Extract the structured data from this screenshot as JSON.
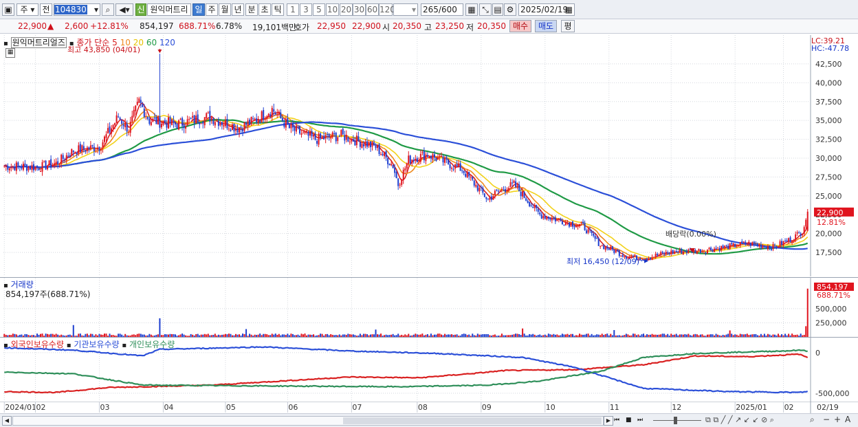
{
  "toolbar": {
    "market": "주",
    "prev_label": "전",
    "code": "104830",
    "new_badge": "신",
    "stock_name": "원익머트리",
    "periods": [
      "일",
      "주",
      "월",
      "년",
      "분",
      "초",
      "틱"
    ],
    "active_period": "일",
    "intervals": [
      "1",
      "3",
      "5",
      "10",
      "20",
      "30",
      "60",
      "120"
    ],
    "count_value": "265",
    "count_max": "/600",
    "date": "2025/02/19"
  },
  "quote": {
    "price": "22,900",
    "change": "2,600",
    "change_pct": "+12.81%",
    "volume": "854,197",
    "volume_ratio": "688.71%",
    "turnover": "6.78%",
    "amount": "19,101백만",
    "ask_label": "호가",
    "ask": "22,950",
    "bid": "22,900",
    "open_label": "시",
    "open": "20,350",
    "high_label": "고",
    "high": "23,250",
    "low_label": "저",
    "low": "20,350",
    "buy_button": "매수",
    "sell_button": "매도",
    "avg_button": "평"
  },
  "price_panel": {
    "name_tag": "원익머트리얼즈",
    "ma_label": "종가 단순",
    "ma_periods": [
      "5",
      "10",
      "20",
      "60",
      "120"
    ],
    "ma_colors": [
      "#d92020",
      "#ef8a1e",
      "#f2d21a",
      "#1f9a45",
      "#2b4fd8"
    ],
    "lc": "LC:39.21",
    "hc": "HC:-47.78",
    "high_annotation": "최고 43,850 (04/01)",
    "low_annotation": "최저 16,450 (12/09)",
    "dividend_annotation": "배당락(0.00%)",
    "last_price": "22,900",
    "last_pct": "12.81%",
    "y_ticks": [
      "42,500",
      "40,000",
      "37,500",
      "35,000",
      "32,500",
      "30,000",
      "27,500",
      "25,000",
      "22,500",
      "20,000",
      "17,500"
    ]
  },
  "volume_panel": {
    "title": "거래량",
    "value": "854,197주(688.71%)",
    "last_value": "854,197",
    "last_pct": "688.71%",
    "y_ticks": [
      "500,000",
      "250,000"
    ]
  },
  "holding_panel": {
    "series": [
      {
        "name": "외국인보유수량",
        "color": "#d92020"
      },
      {
        "name": "기관보유수량",
        "color": "#2b4fd8"
      },
      {
        "name": "개인보유수량",
        "color": "#2f8f5a"
      }
    ],
    "y_ticks": [
      "0",
      "-500,000"
    ]
  },
  "x_axis": {
    "labels": [
      "2024/01",
      "02",
      "03",
      "04",
      "05",
      "06",
      "07",
      "08",
      "09",
      "10",
      "11",
      "12",
      "2025/01",
      "02"
    ],
    "last_date": "02/19"
  },
  "chart_data": {
    "type": "line",
    "price_ylim": [
      15500,
      44500
    ],
    "key_points": [
      {
        "date": "2024/04/01",
        "label": "최고",
        "value": 43850
      },
      {
        "date": "2024/12/09",
        "label": "최저",
        "value": 16450
      },
      {
        "date": "2025/02/19",
        "label": "last",
        "value": 22900
      }
    ]
  }
}
